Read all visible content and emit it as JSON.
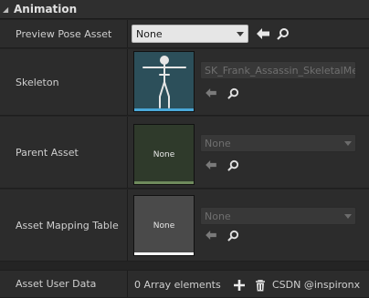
{
  "section": {
    "title": "Animation"
  },
  "preview_pose": {
    "label": "Preview Pose Asset",
    "value": "None"
  },
  "skeleton": {
    "label": "Skeleton",
    "value": "SK_Frank_Assassin_SkeletalMe"
  },
  "parent_asset": {
    "label": "Parent Asset",
    "thumb_text": "None",
    "value": "None"
  },
  "mapping_table": {
    "label": "Asset Mapping Table",
    "thumb_text": "None",
    "value": "None"
  },
  "user_data": {
    "label": "Asset User Data",
    "count": "0 Array elements"
  },
  "watermark": "CSDN @inspironx",
  "colors": {
    "skeleton_thumb_bg": "#2c4f5a",
    "skeleton_bar": "#4aa8d8",
    "parent_thumb_bg": "#2f3a2b",
    "parent_bar": "#6f8b5d",
    "mapping_thumb_bg": "#4a4a4a",
    "mapping_bar": "#ffffff"
  },
  "icons": [
    "collapse-arrow-icon",
    "use-selected-arrow-icon",
    "browse-magnifier-icon",
    "add-plus-icon",
    "delete-trash-icon"
  ]
}
